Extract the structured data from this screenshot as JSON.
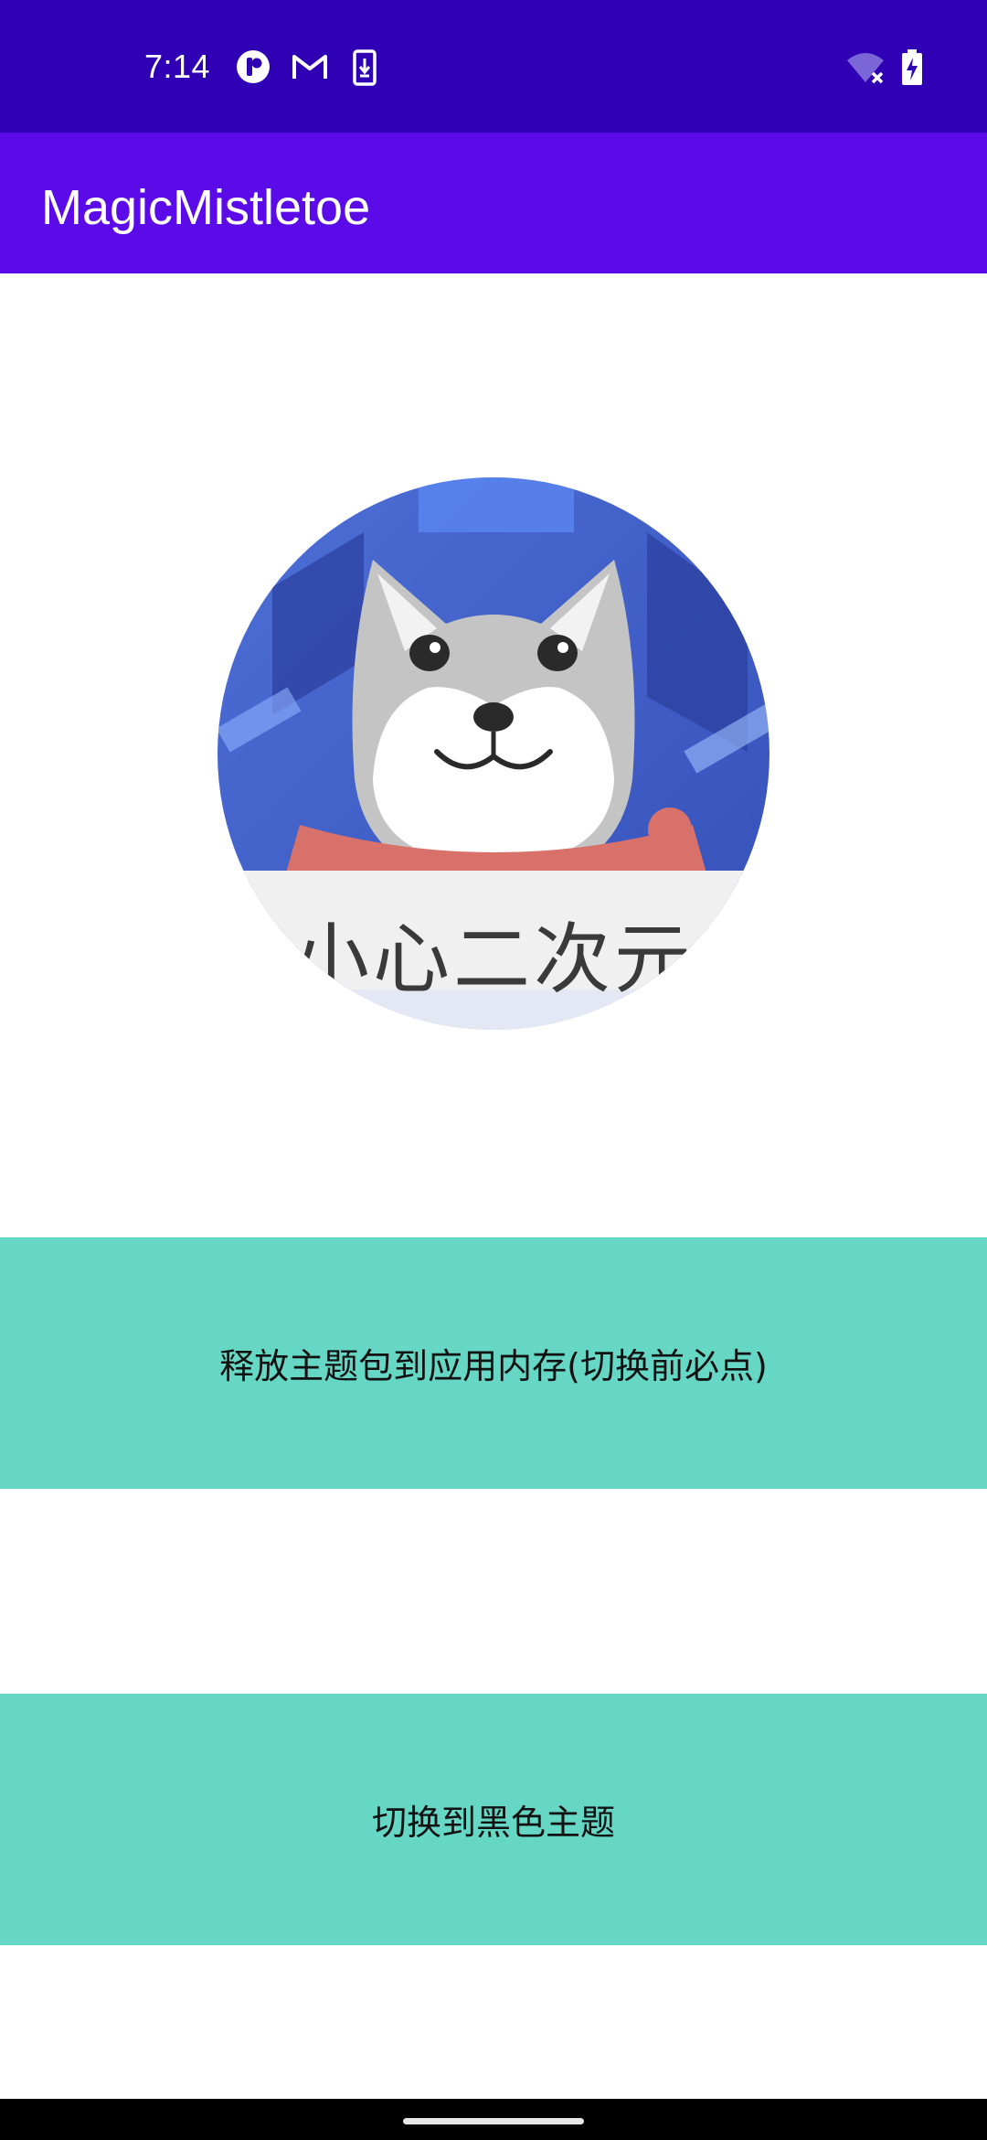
{
  "status_bar": {
    "time": "7:14",
    "left_icons": [
      "app-notification-icon",
      "gmail-icon",
      "download-icon"
    ],
    "right_icons": [
      "wifi-off-icon",
      "battery-charging-icon"
    ]
  },
  "app_bar": {
    "title": "MagicMistletoe"
  },
  "avatar": {
    "caption": "小心二次元"
  },
  "buttons": {
    "release": "释放主题包到应用内存(切换前必点)",
    "switch_theme": "切换到黑色主题"
  },
  "colors": {
    "status_bar": "#3000b4",
    "app_bar": "#5b0be8",
    "button": "#66d7c5"
  }
}
